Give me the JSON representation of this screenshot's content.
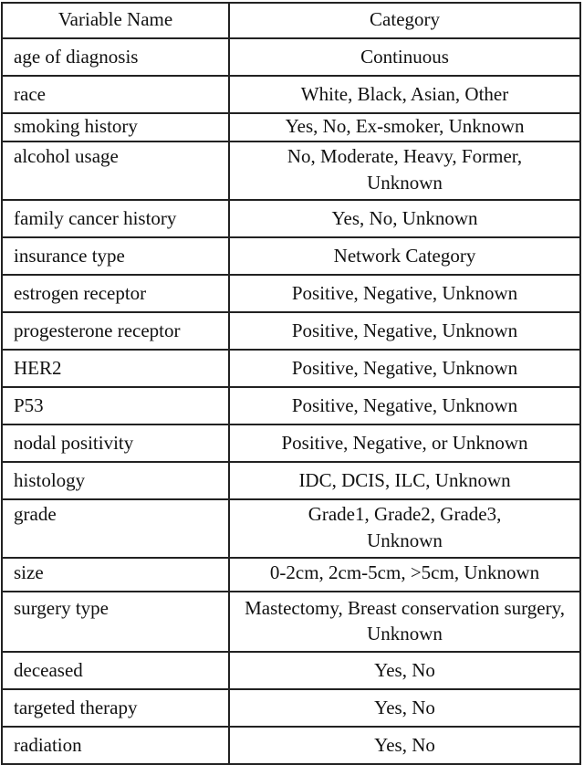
{
  "table": {
    "headers": [
      "Variable Name",
      "Category"
    ],
    "rows": [
      {
        "variable": "age of diagnosis",
        "category": "Continuous"
      },
      {
        "variable": "race",
        "category": "White, Black, Asian, Other"
      },
      {
        "variable": "smoking history",
        "category": "Yes, No, Ex-smoker, Unknown"
      },
      {
        "variable": "alcohol usage",
        "category": "No, Moderate, Heavy, Former, Unknown"
      },
      {
        "variable": "family cancer history",
        "category": "Yes, No, Unknown"
      },
      {
        "variable": "insurance type",
        "category": "Network Category"
      },
      {
        "variable": "estrogen receptor",
        "category": "Positive, Negative, Unknown"
      },
      {
        "variable": "progesterone receptor",
        "category": "Positive, Negative, Unknown"
      },
      {
        "variable": "HER2",
        "category": "Positive, Negative, Unknown"
      },
      {
        "variable": "P53",
        "category": "Positive, Negative, Unknown"
      },
      {
        "variable": "nodal positivity",
        "category": "Positive, Negative, or Unknown"
      },
      {
        "variable": "histology",
        "category": "IDC, DCIS, ILC, Unknown"
      },
      {
        "variable": "grade",
        "category": "Grade1, Grade2, Grade3, Unknown"
      },
      {
        "variable": "size",
        "category": "0-2cm, 2cm-5cm, >5cm, Unknown"
      },
      {
        "variable": "surgery type",
        "category": "Mastectomy, Breast conservation surgery, Unknown"
      },
      {
        "variable": "deceased",
        "category": "Yes, No"
      },
      {
        "variable": "targeted therapy",
        "category": "Yes, No"
      },
      {
        "variable": "radiation",
        "category": "Yes, No"
      }
    ]
  }
}
